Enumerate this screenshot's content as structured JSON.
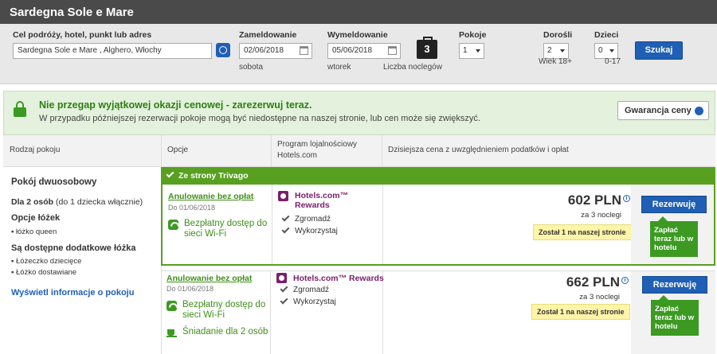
{
  "header": {
    "title": "Sardegna Sole e Mare",
    "destination_label": "Cel podróży, hotel, punkt lub adres",
    "destination_value": "Sardegna Sole e Mare , Alghero, Włochy",
    "checkin_label": "Zameldowanie",
    "checkin_value": "02/06/2018",
    "checkin_day": "sobota",
    "checkout_label": "Wymeldowanie",
    "checkout_value": "05/06/2018",
    "checkout_day": "wtorek",
    "nights_count": "3",
    "nights_label": "Liczba noclegów",
    "rooms_label": "Pokoje",
    "rooms_value": "1",
    "adults_label": "Dorośli",
    "adults_value": "2",
    "adults_note": "Wiek 18+",
    "children_label": "Dzieci",
    "children_value": "0",
    "children_note": "0-17",
    "search_button": "Szukaj"
  },
  "promo": {
    "title": "Nie przegap wyjątkowej okazji cenowej - zarezerwuj teraz.",
    "text": "W przypadku późniejszej rezerwacji pokoje mogą być niedostępne na naszej stronie, lub cen może się zwiększyć.",
    "guarantee_button": "Gwarancja ceny"
  },
  "table_headers": {
    "room_type": "Rodzaj pokoju",
    "options": "Opcje",
    "loyalty_line1": "Program lojalnościowy",
    "loyalty_line2": "Hotels.com",
    "price": "Dzisiejsza cena z uwzględnieniem podatków i opłat"
  },
  "room": {
    "name": "Pokój dwuosobowy",
    "occupancy_bold": "Dla 2 osób",
    "occupancy_rest": " (do 1 dziecka włącznie)",
    "beds_heading": "Opcje łóżek",
    "beds": [
      "łóżko queen"
    ],
    "extra_heading": "Są dostępne dodatkowe łóżka",
    "extra": [
      "Łóżeczko dziecięce",
      "Łóżko dostawiane"
    ],
    "info_link": "Wyświetl informacje o pokoju"
  },
  "banner": "Ze strony Trivago",
  "offers": [
    {
      "cancel": "Anulowanie bez opłat",
      "until": "Do 01/06/2018",
      "features": [
        "Bezpłatny dostęp do sieci Wi-Fi"
      ],
      "rewards_name": "Hotels.com™ Rewards",
      "collect": "Zgromadź",
      "redeem": "Wykorzystaj",
      "price": "602 PLN",
      "nights": "za 3 noclegi",
      "left": "Został 1 na naszej stronie",
      "book": "Rezerwuję",
      "pay": "Zapłać teraz lub w hotelu"
    },
    {
      "cancel": "Anulowanie bez opłat",
      "until": "Do 01/06/2018",
      "features": [
        "Bezpłatny dostęp do sieci Wi-Fi",
        "Śniadanie dla 2 osób"
      ],
      "rewards_name": "Hotels.com™ Rewards",
      "collect": "Zgromadź",
      "redeem": "Wykorzystaj",
      "price": "662 PLN",
      "nights": "za 3 noclegi",
      "left": "Został 1 na naszej stronie",
      "book": "Rezerwuję",
      "pay": "Zapłać teraz lub w hotelu"
    }
  ]
}
